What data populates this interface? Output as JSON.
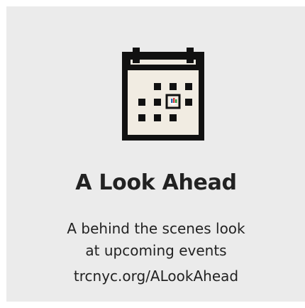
{
  "card": {
    "title": "A Look Ahead",
    "description_line1": "A behind the scenes look",
    "description_line2": "at upcoming events",
    "url": "trcnyc.org/ALookAhead"
  },
  "colors": {
    "background": "#ebebeb",
    "icon": "#111111",
    "calendar_fill": "#f1ece2",
    "text": "#222222"
  },
  "icons": {
    "main": "calendar-icon"
  }
}
